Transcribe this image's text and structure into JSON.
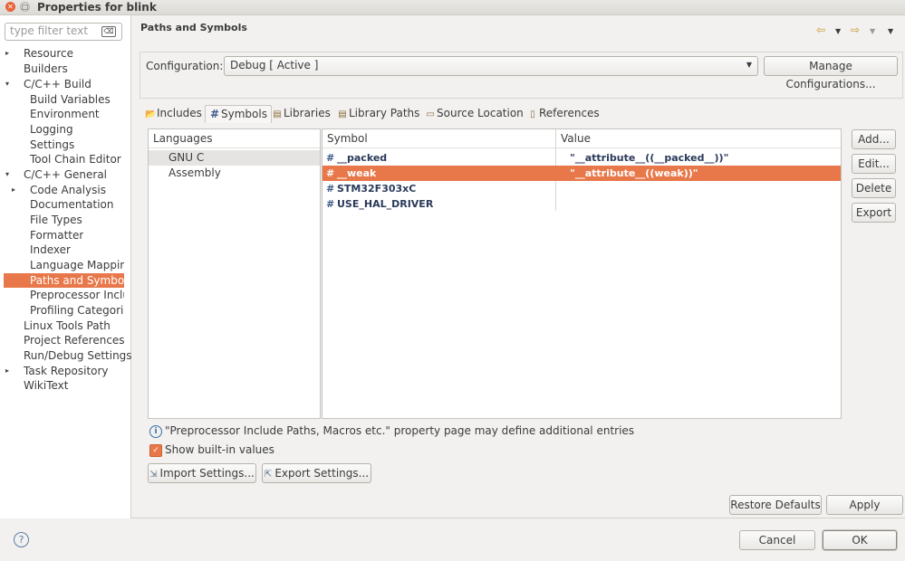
{
  "window": {
    "title": "Properties for blink"
  },
  "sidebar": {
    "filter_placeholder": "type filter text",
    "items": [
      {
        "label": "Resource",
        "expandable": true
      },
      {
        "label": "Builders"
      },
      {
        "label": "C/C++ Build",
        "expanded": true
      },
      {
        "label": "Build Variables"
      },
      {
        "label": "Environment"
      },
      {
        "label": "Logging"
      },
      {
        "label": "Settings"
      },
      {
        "label": "Tool Chain Editor"
      },
      {
        "label": "C/C++ General",
        "expanded": true
      },
      {
        "label": "Code Analysis",
        "expandable": true
      },
      {
        "label": "Documentation"
      },
      {
        "label": "File Types"
      },
      {
        "label": "Formatter"
      },
      {
        "label": "Indexer"
      },
      {
        "label": "Language Mapping"
      },
      {
        "label": "Paths and Symbols",
        "selected": true
      },
      {
        "label": "Preprocessor Include"
      },
      {
        "label": "Profiling Categories"
      },
      {
        "label": "Linux Tools Path"
      },
      {
        "label": "Project References"
      },
      {
        "label": "Run/Debug Settings"
      },
      {
        "label": "Task Repository",
        "expandable": true
      },
      {
        "label": "WikiText"
      }
    ]
  },
  "main": {
    "title": "Paths and Symbols",
    "configuration": {
      "label": "Configuration:",
      "value": "Debug  [ Active ]",
      "manage_button": "Manage Configurations..."
    },
    "tabs": [
      {
        "label": "Includes",
        "icon": "includes-icon"
      },
      {
        "label": "Symbols",
        "icon": "hash-icon",
        "active": true
      },
      {
        "label": "Libraries",
        "icon": "libraries-icon"
      },
      {
        "label": "Library Paths",
        "icon": "library-paths-icon"
      },
      {
        "label": "Source Location",
        "icon": "folder-icon"
      },
      {
        "label": "References",
        "icon": "references-icon"
      }
    ],
    "languages": {
      "header": "Languages",
      "items": [
        "GNU C",
        "Assembly"
      ],
      "selected": "GNU C"
    },
    "symbols": {
      "columns": [
        "Symbol",
        "Value"
      ],
      "rows": [
        {
          "symbol": "__packed",
          "value": "\"__attribute__((__packed__))\""
        },
        {
          "symbol": "__weak",
          "value": "\"__attribute__((weak))\"",
          "selected": true
        },
        {
          "symbol": "STM32F303xC",
          "value": ""
        },
        {
          "symbol": "USE_HAL_DRIVER",
          "value": ""
        }
      ]
    },
    "side_buttons": [
      "Add...",
      "Edit...",
      "Delete",
      "Export"
    ],
    "info_text": "\"Preprocessor Include Paths, Macros etc.\" property page may define additional entries",
    "show_builtin": {
      "label": "Show built-in values",
      "checked": true
    },
    "import_button": "Import Settings...",
    "export_button": "Export Settings...",
    "restore_defaults": "Restore Defaults",
    "apply": "Apply"
  },
  "footer": {
    "cancel": "Cancel",
    "ok": "OK"
  },
  "colors": {
    "accent": "#e8784a",
    "selection": "#e8784a"
  }
}
